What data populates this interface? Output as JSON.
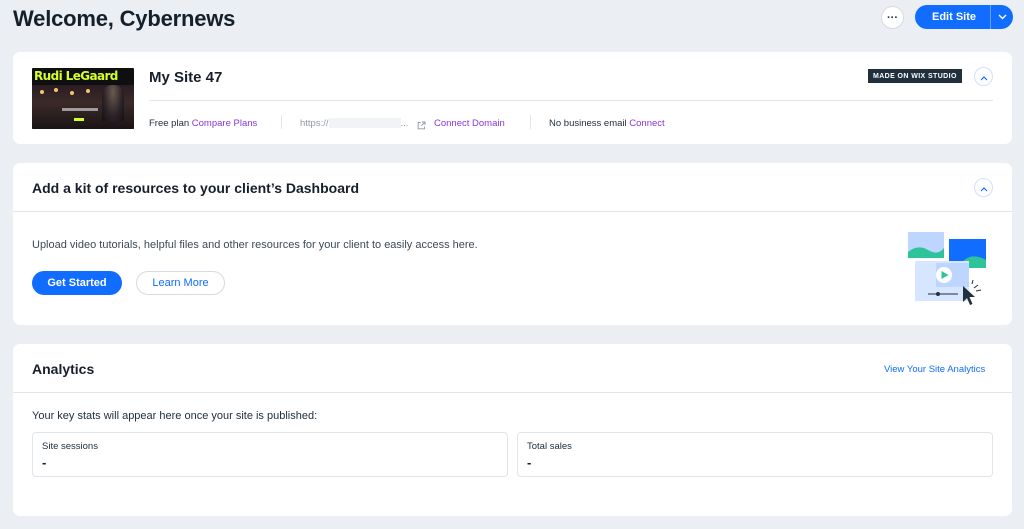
{
  "header": {
    "title": "Welcome, Cybernews",
    "more_label": "···",
    "edit_site_label": "Edit Site"
  },
  "site_card": {
    "thumbnail_brand": "Rudi LeGaard",
    "site_name": "My Site 47",
    "made_on_badge": "MADE ON WIX STUDIO",
    "plan_label": "Free plan",
    "compare_plans_link": "Compare Plans",
    "url_prefix": "https://",
    "url_suffix": "...",
    "connect_domain_link": "Connect Domain",
    "email_status": "No business email",
    "connect_email_link": "Connect"
  },
  "kit_card": {
    "title": "Add a kit of resources to your client’s Dashboard",
    "description": "Upload video tutorials, helpful files and other resources for your client to easily access here.",
    "primary_button": "Get Started",
    "secondary_button": "Learn More"
  },
  "analytics_card": {
    "title": "Analytics",
    "view_link": "View Your Site Analytics",
    "intro": "Your key stats will appear here once your site is published:",
    "stats": [
      {
        "label": "Site sessions",
        "value": "-"
      },
      {
        "label": "Total sales",
        "value": "-"
      }
    ]
  },
  "colors": {
    "accent": "#116dff",
    "link_purple": "#8a36d8",
    "background": "#ebeef3",
    "badge_dark": "#20303c",
    "brand_lime": "#d4ff2b"
  },
  "icons": {
    "more": "ellipsis-icon",
    "edit_dropdown": "chevron-down-icon",
    "collapse": "chevron-up-icon",
    "external": "external-link-icon",
    "illustration": "media-resources-illustration"
  }
}
